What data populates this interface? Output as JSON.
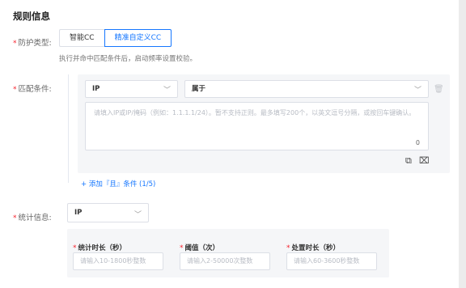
{
  "section_title": "规则信息",
  "protection": {
    "label": "防护类型:",
    "options": [
      "智能CC",
      "精准自定义CC"
    ],
    "selected": "精准自定义CC",
    "hint": "执行并命中匹配条件后，启动频率设置校验。"
  },
  "match": {
    "label": "匹配条件:",
    "field_value": "IP",
    "operator_value": "属于",
    "textarea_placeholder": "请填入IP或IP/掩码（例如：1.1.1.1/24）。暂不支持正则。最多填写200个，以英文逗号分隔，或按回车键确认。",
    "char_count": "0",
    "add_condition": "+ 添加『且』条件 (1/5)"
  },
  "stats": {
    "label": "统计信息:",
    "select_value": "IP",
    "fields": [
      {
        "label": "统计时长（秒）",
        "placeholder": "请输入10-1800秒整数"
      },
      {
        "label": "阈值（次）",
        "placeholder": "请输入2-50000次整数"
      },
      {
        "label": "处置时长（秒）",
        "placeholder": "请输入60-3600秒整数"
      }
    ]
  },
  "icons": {
    "trash": "trash-icon",
    "copy": "copy-icon",
    "clear": "clear-icon",
    "chevron": "chevron-down-icon"
  },
  "colors": {
    "accent": "#1677ff",
    "required": "#f5222d",
    "panel_bg": "#f5f6f8"
  }
}
